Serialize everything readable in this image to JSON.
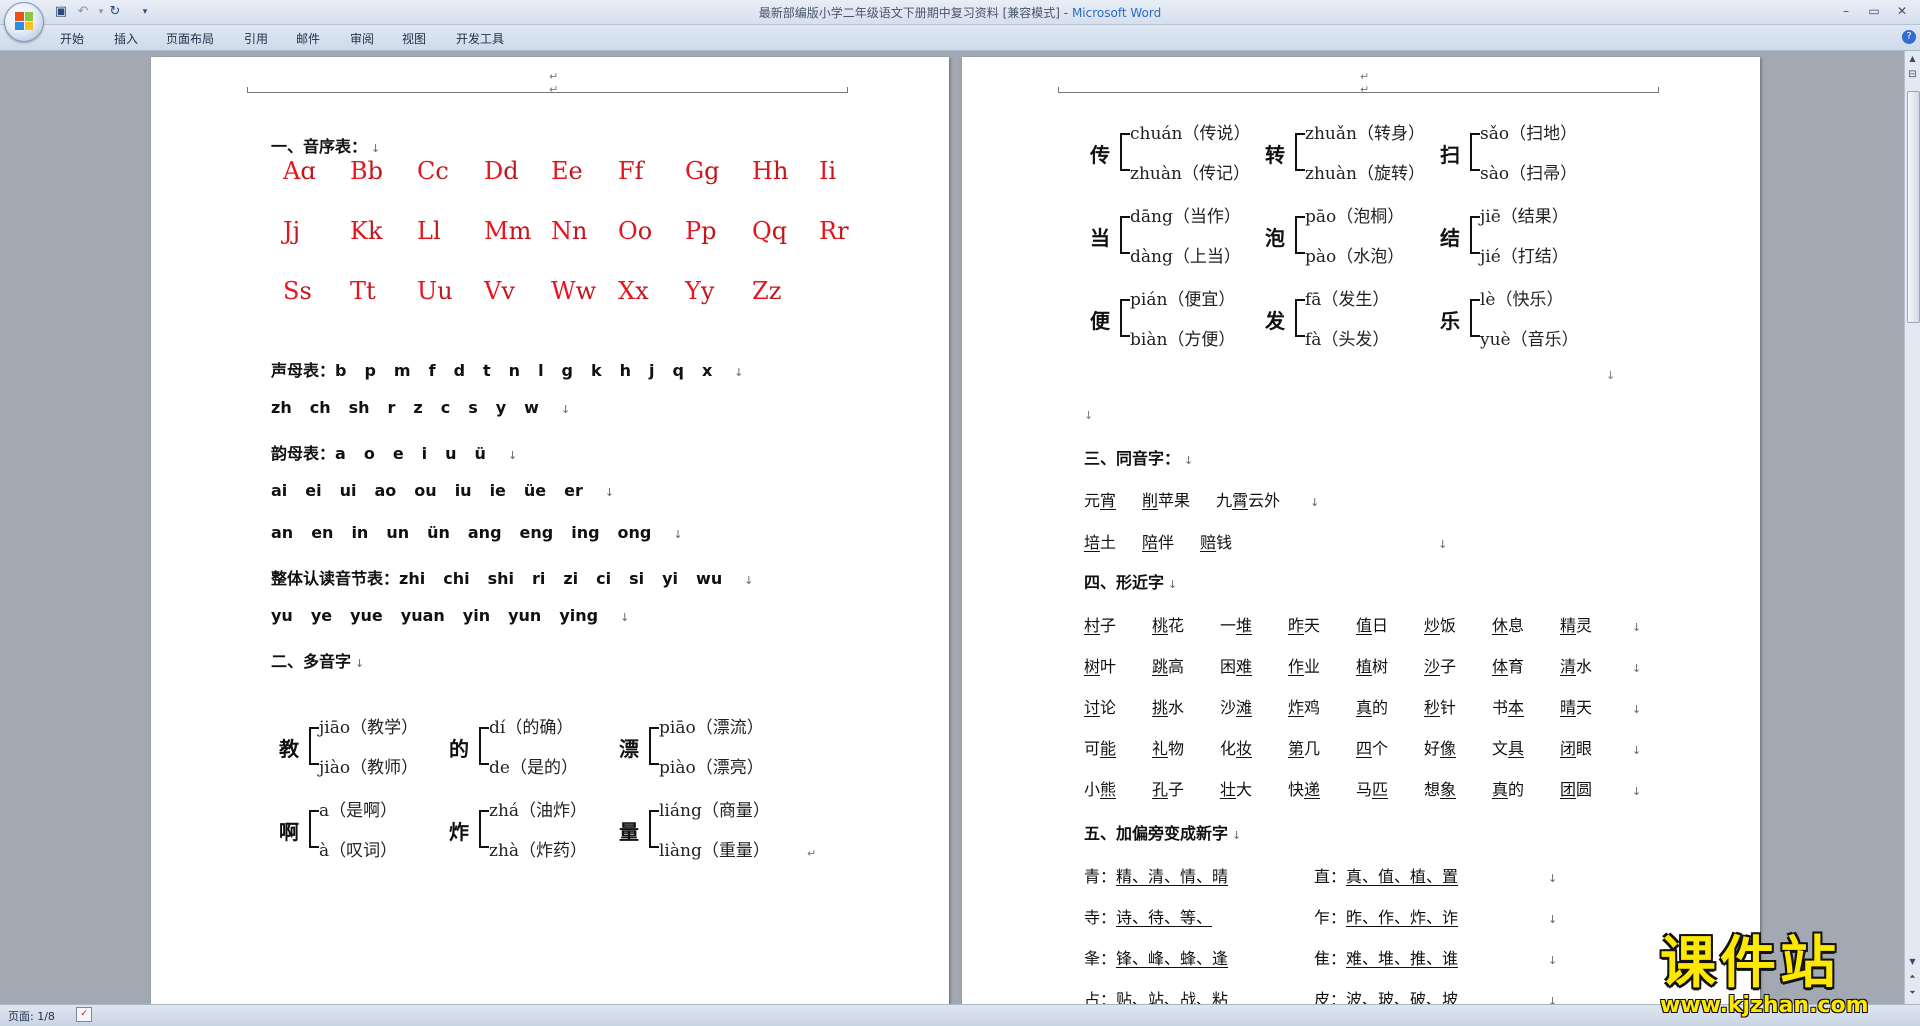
{
  "window": {
    "title": "最新部编版小学二年级语文下册期中复习资料 [兼容模式]",
    "app": "Microsoft Word"
  },
  "ribbon": {
    "tabs": [
      "开始",
      "插入",
      "页面布局",
      "引用",
      "邮件",
      "审阅",
      "视图",
      "开发工具"
    ]
  },
  "status": {
    "page": "页面: 1/8"
  },
  "left_page": {
    "s1_title": "一、音序表：",
    "alphabet": [
      [
        [
          "A",
          "ɑ"
        ],
        [
          "B",
          "b"
        ],
        [
          "C",
          "c"
        ],
        [
          "D",
          "d"
        ],
        [
          "E",
          "e"
        ],
        [
          "F",
          "f"
        ],
        [
          "G",
          "g"
        ],
        [
          "H",
          "h"
        ],
        [
          "I",
          "i"
        ]
      ],
      [
        [
          "J",
          "j"
        ],
        [
          "K",
          "k"
        ],
        [
          "L",
          "l"
        ],
        [
          "M",
          "m"
        ],
        [
          "N",
          "n"
        ],
        [
          "O",
          "o"
        ],
        [
          "P",
          "p"
        ],
        [
          "Q",
          "q"
        ],
        [
          "R",
          "r"
        ]
      ],
      [
        [
          "S",
          "s"
        ],
        [
          "T",
          "t"
        ],
        [
          "U",
          "u"
        ],
        [
          "V",
          "v"
        ],
        [
          "W",
          "w"
        ],
        [
          "X",
          "x"
        ],
        [
          "Y",
          "y"
        ],
        [
          "Z",
          "z"
        ]
      ]
    ],
    "shengmu_label": "声母表：",
    "shengmu1": [
      "b",
      "p",
      "m",
      "f",
      "d",
      "t",
      "n",
      "l",
      "g",
      "k",
      "h",
      "j",
      "q",
      "x"
    ],
    "shengmu2": [
      "zh",
      "ch",
      "sh",
      "r",
      "z",
      "c",
      "s",
      "y",
      "w"
    ],
    "yunmu_label": "韵母表：",
    "yunmu1": [
      "a",
      "o",
      "e",
      "i",
      "u",
      "ü"
    ],
    "yunmu2": [
      "ai",
      "ei",
      "ui",
      "ao",
      "ou",
      "iu",
      "ie",
      "üe",
      "er"
    ],
    "yunmu3": [
      "an",
      "en",
      "in",
      "un",
      "ün",
      "ang",
      "eng",
      "ing",
      "ong"
    ],
    "zhengti_label": "整体认读音节表：",
    "zhengti1": [
      "zhi",
      "chi",
      "shi",
      "ri",
      "zi",
      "ci",
      "si",
      "yi",
      "wu"
    ],
    "zhengti2": [
      "yu",
      "ye",
      "yue",
      "yuan",
      "yin",
      "yun",
      "ying"
    ],
    "s2_title": "二、多音字",
    "duoyin": [
      {
        "char": "教",
        "top": "jiāo（教学）",
        "bottom": "jiào（教师）"
      },
      {
        "char": "的",
        "top": "dí（的确）",
        "bottom": "de（是的）"
      },
      {
        "char": "漂",
        "top": "piāo（漂流）",
        "bottom": "piào（漂亮）"
      },
      {
        "char": "啊",
        "top": "a（是啊）",
        "bottom": "à（叹词）"
      },
      {
        "char": "炸",
        "top": "zhá（油炸）",
        "bottom": "zhà（炸药）"
      },
      {
        "char": "量",
        "top": "liáng（商量）",
        "bottom": "liàng（重量）"
      }
    ]
  },
  "right_page": {
    "duoyin": [
      {
        "char": "传",
        "top": "chuán（传说）",
        "bottom": "zhuàn（传记）"
      },
      {
        "char": "转",
        "top": "zhuǎn（转身）",
        "bottom": "zhuàn（旋转）"
      },
      {
        "char": "扫",
        "top": "sǎo（扫地）",
        "bottom": "sào（扫帚）"
      },
      {
        "char": "当",
        "top": "dāng（当作）",
        "bottom": "dàng（上当）"
      },
      {
        "char": "泡",
        "top": "pāo（泡桐）",
        "bottom": "pào（水泡）"
      },
      {
        "char": "结",
        "top": "jiē（结果）",
        "bottom": "jié（打结）"
      },
      {
        "char": "便",
        "top": "pián（便宜）",
        "bottom": "biàn（方便）"
      },
      {
        "char": "发",
        "top": "fā（发生）",
        "bottom": "fà（头发）"
      },
      {
        "char": "乐",
        "top": "lè（快乐）",
        "bottom": "yuè（音乐）"
      }
    ],
    "s3_title": "三、同音字：",
    "tongyin": [
      [
        {
          "p": "元",
          "u": "宵"
        },
        {
          "p": "",
          "u": "削",
          "s": "苹果"
        },
        {
          "p": "九",
          "u": "霄",
          "s": "云外"
        }
      ],
      [
        {
          "p": "",
          "u": "培",
          "s": "土"
        },
        {
          "p": "",
          "u": "陪",
          "s": "伴"
        },
        {
          "p": "",
          "u": "赔",
          "s": "钱"
        }
      ]
    ],
    "s4_title": "四、形近字",
    "xingjin": [
      [
        [
          "",
          "村",
          "子"
        ],
        [
          "",
          "桃",
          "花"
        ],
        [
          "一",
          "堆",
          ""
        ],
        [
          "",
          "昨",
          "天"
        ],
        [
          "",
          "值",
          "日"
        ],
        [
          "",
          "炒",
          "饭"
        ],
        [
          "",
          "休",
          "息"
        ],
        [
          "",
          "精",
          "灵"
        ]
      ],
      [
        [
          "",
          "树",
          "叶"
        ],
        [
          "",
          "跳",
          "高"
        ],
        [
          "困",
          "难",
          ""
        ],
        [
          "",
          "作",
          "业"
        ],
        [
          "",
          "植",
          "树"
        ],
        [
          "",
          "沙",
          "子"
        ],
        [
          "",
          "体",
          "育"
        ],
        [
          "",
          "清",
          "水"
        ]
      ],
      [
        [
          "",
          "讨",
          "论"
        ],
        [
          "",
          "挑",
          "水"
        ],
        [
          "沙",
          "滩",
          ""
        ],
        [
          "",
          "炸",
          "鸡"
        ],
        [
          "",
          "真",
          "的"
        ],
        [
          "",
          "秒",
          "针"
        ],
        [
          "书",
          "本",
          ""
        ],
        [
          "",
          "晴",
          "天"
        ]
      ],
      [
        [
          "可",
          "能",
          ""
        ],
        [
          "",
          "礼",
          "物"
        ],
        [
          "化",
          "妆",
          ""
        ],
        [
          "",
          "第",
          "几"
        ],
        [
          "",
          "四",
          "个"
        ],
        [
          "好",
          "像",
          ""
        ],
        [
          "文",
          "具",
          ""
        ],
        [
          "",
          "闭",
          "眼"
        ]
      ],
      [
        [
          "小",
          "熊",
          ""
        ],
        [
          "",
          "孔",
          "子"
        ],
        [
          "",
          "壮",
          "大"
        ],
        [
          "快",
          "递",
          ""
        ],
        [
          "马",
          "匹",
          ""
        ],
        [
          "想",
          "象",
          ""
        ],
        [
          "",
          "真",
          "的"
        ],
        [
          "",
          "团",
          "圆"
        ]
      ]
    ],
    "s5_title": "五、加偏旁变成新字",
    "pianpang": [
      [
        {
          "k": "青：",
          "v": "精、清、情、晴"
        },
        {
          "k": "直：",
          "v": "真、值、植、置"
        }
      ],
      [
        {
          "k": "寺：",
          "v": "诗、待、等、"
        },
        {
          "k": "乍：",
          "v": "昨、作、炸、诈"
        }
      ],
      [
        {
          "k": "夆：",
          "v": "锋、峰、蜂、逢"
        },
        {
          "k": "隹：",
          "v": "难、堆、推、谁"
        }
      ],
      [
        {
          "k": "占：",
          "v": "贴、站、战、粘"
        },
        {
          "k": "皮：",
          "v": "波、玻、破、坡"
        }
      ]
    ]
  },
  "watermark": {
    "big": "课件站",
    "small": "www.kjzhan.com"
  }
}
